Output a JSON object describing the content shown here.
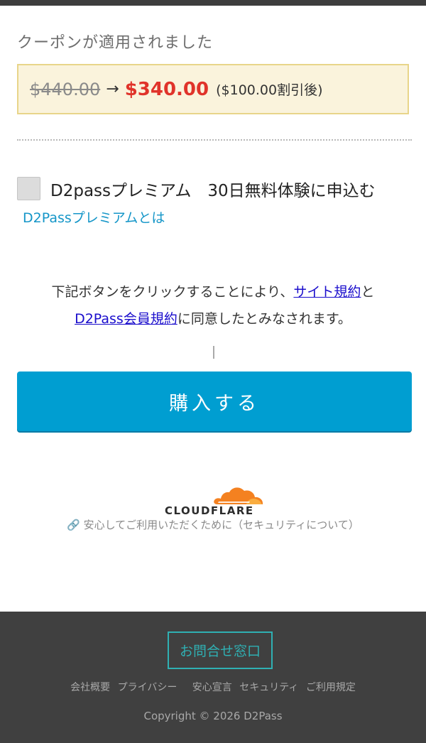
{
  "coupon": {
    "title": "クーポンが適用されました",
    "original_price": "$440.00",
    "arrow": "→",
    "new_price": "$340.00",
    "discount_note": "($100.00割引後)"
  },
  "premium": {
    "checkbox_checked": false,
    "label": "D2passプレミアム　30日無料体験に申込む",
    "link": "D2Passプレミアムとは"
  },
  "consent": {
    "text_before": "下記ボタンをクリックすることにより、",
    "site_terms_link": "サイト規約",
    "text_and": "と",
    "member_terms_link": "D2Pass会員規約",
    "text_after": "に同意したとみなされます。"
  },
  "purchase": {
    "button_label": "購入する"
  },
  "security": {
    "logo_text": "CLOUDFLARE",
    "logo_icon": "cloudflare-logo",
    "link_icon": "link-icon",
    "link_text": "安心してご利用いただくために（セキュリティについて）"
  },
  "footer": {
    "contact_button": "お問合せ窓口",
    "links": [
      "会社概要",
      "プライバシー",
      "安心宣言",
      "セキュリティ",
      "ご利用規定"
    ],
    "copyright": "Copyright © 2026 D2Pass"
  },
  "colors": {
    "accent_blue": "#009ed1",
    "price_red": "#e0332a",
    "link_blue": "#1596c8",
    "footer_bg": "#404040",
    "footer_teal": "#2fb0b3",
    "cloudflare_orange": "#f48120"
  }
}
